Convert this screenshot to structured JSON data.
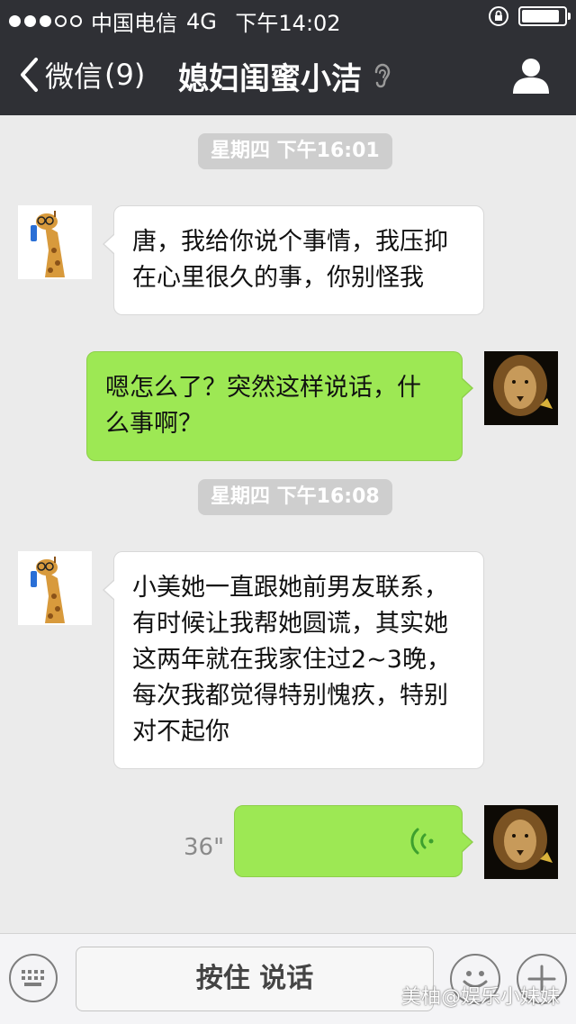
{
  "status_bar": {
    "carrier": "中国电信",
    "network": "4G",
    "time": "下午14:02",
    "signal_dots_filled": 3,
    "signal_dots_total": 5,
    "battery_level": 0.9
  },
  "nav": {
    "back_label": "微信",
    "unread_count": "(9)",
    "title": "媳妇闺蜜小洁",
    "icons": [
      "chevron-left-icon",
      "ear-icon",
      "person-icon"
    ]
  },
  "chat": {
    "timestamps": [
      "星期四 下午16:01",
      "星期四 下午16:08"
    ],
    "messages": [
      {
        "sender": "contact",
        "text": "唐，我给你说个事情，我压抑\n在心里很久的事，你别怪我"
      },
      {
        "sender": "me",
        "text": "嗯怎么了？突然这样说话，什\n么事啊？"
      },
      {
        "sender": "contact",
        "text": "小美她一直跟她前男友联系，\n有时候让我帮她圆谎，其实她\n这两年就在我家住过2~3晚，\n每次我都觉得特别愧疚，特别\n对不起你"
      },
      {
        "sender": "me",
        "type": "voice",
        "duration": "36\""
      }
    ]
  },
  "input_bar": {
    "hold_to_talk_label": "按住 说话",
    "icons": [
      "keyboard-icon",
      "emoji-icon",
      "plus-icon"
    ]
  },
  "watermark": "美柚@娱乐小妹妹",
  "colors": {
    "nav_background": "#2f3035",
    "chat_background": "#ebebeb",
    "my_bubble": "#9de854",
    "contact_bubble": "#ffffff"
  }
}
